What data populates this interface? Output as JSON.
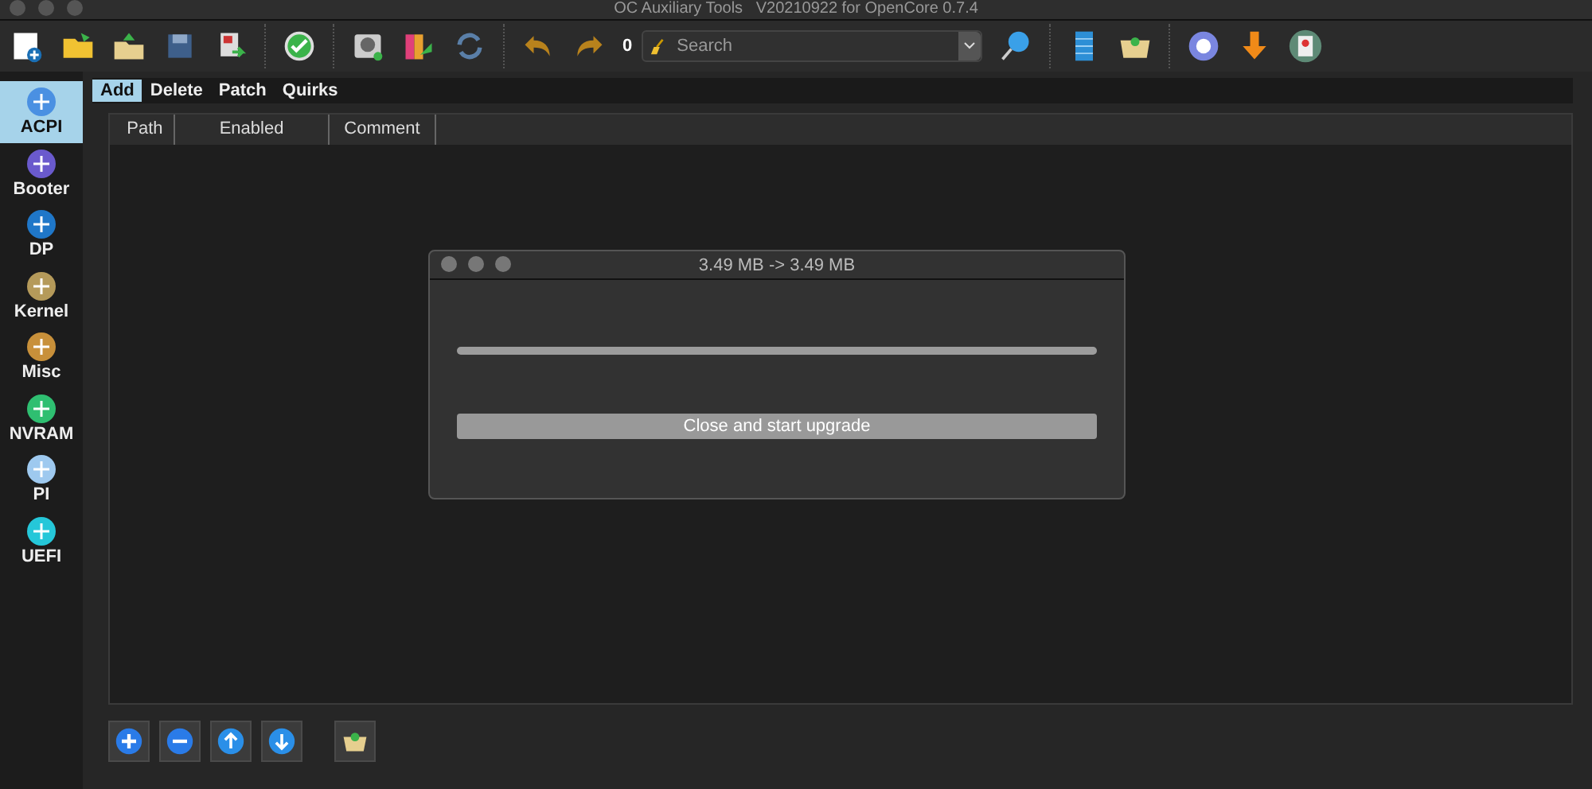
{
  "window": {
    "title": "OC Auxiliary Tools   V20210922 for OpenCore 0.7.4"
  },
  "toolbar": {
    "counter": "0",
    "search": {
      "placeholder": "Search"
    }
  },
  "sidebar": {
    "items": [
      {
        "label": "ACPI",
        "selected": true
      },
      {
        "label": "Booter",
        "selected": false
      },
      {
        "label": "DP",
        "selected": false
      },
      {
        "label": "Kernel",
        "selected": false
      },
      {
        "label": "Misc",
        "selected": false
      },
      {
        "label": "NVRAM",
        "selected": false
      },
      {
        "label": "PI",
        "selected": false
      },
      {
        "label": "UEFI",
        "selected": false
      }
    ]
  },
  "tabs": [
    {
      "label": "Add",
      "selected": true
    },
    {
      "label": "Delete",
      "selected": false
    },
    {
      "label": "Patch",
      "selected": false
    },
    {
      "label": "Quirks",
      "selected": false
    }
  ],
  "table": {
    "columns": [
      "Path",
      "Enabled",
      "Comment"
    ]
  },
  "dialog": {
    "title": "3.49 MB -> 3.49 MB",
    "progress": {
      "level": 1
    },
    "button": "Close and start upgrade"
  }
}
